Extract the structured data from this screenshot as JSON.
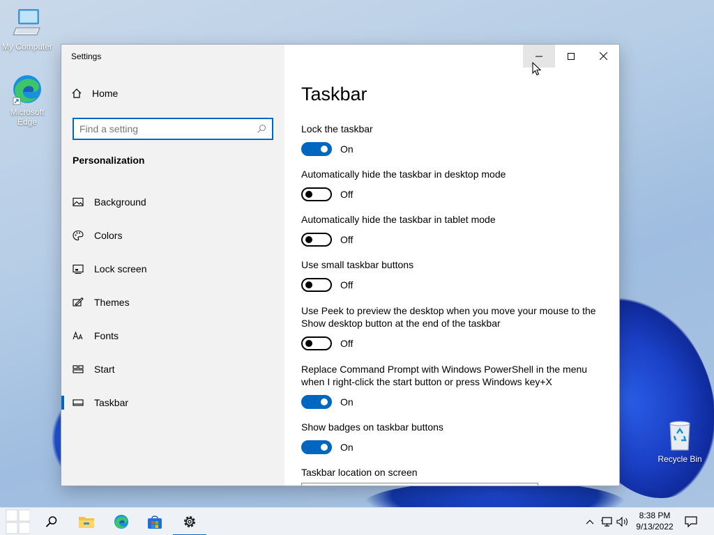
{
  "desktop": {
    "icons": [
      {
        "label": "My Computer"
      },
      {
        "label": "Microsoft\nEdge"
      },
      {
        "label": "Recycle Bin"
      }
    ]
  },
  "window": {
    "app_title": "Settings",
    "sidebar": {
      "home_label": "Home",
      "search_placeholder": "Find a setting",
      "section_label": "Personalization",
      "items": [
        {
          "label": "Background",
          "icon": "picture-icon"
        },
        {
          "label": "Colors",
          "icon": "palette-icon"
        },
        {
          "label": "Lock screen",
          "icon": "lock-screen-icon"
        },
        {
          "label": "Themes",
          "icon": "themes-icon"
        },
        {
          "label": "Fonts",
          "icon": "fonts-icon"
        },
        {
          "label": "Start",
          "icon": "start-icon"
        },
        {
          "label": "Taskbar",
          "icon": "taskbar-icon",
          "active": true
        }
      ]
    },
    "content": {
      "title": "Taskbar",
      "settings": [
        {
          "label": "Lock the taskbar",
          "state": "On"
        },
        {
          "label": "Automatically hide the taskbar in desktop mode",
          "state": "Off"
        },
        {
          "label": "Automatically hide the taskbar in tablet mode",
          "state": "Off"
        },
        {
          "label": "Use small taskbar buttons",
          "state": "Off"
        },
        {
          "label": "Use Peek to preview the desktop when you move your mouse to the Show desktop button at the end of the taskbar",
          "state": "Off"
        },
        {
          "label": "Replace Command Prompt with Windows PowerShell in the menu when I right-click the start button or press Windows key+X",
          "state": "On"
        },
        {
          "label": "Show badges on taskbar buttons",
          "state": "On"
        },
        {
          "label": "Taskbar location on screen",
          "state": ""
        }
      ]
    }
  },
  "taskbar": {
    "clock_time": "8:38 PM",
    "clock_date": "9/13/2022"
  },
  "colors": {
    "accent": "#0067c0"
  }
}
